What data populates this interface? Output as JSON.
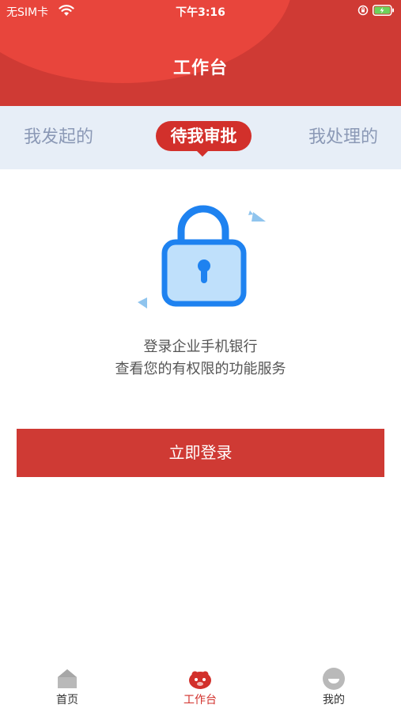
{
  "status_bar": {
    "carrier": "无SIM卡",
    "time": "下午3:16"
  },
  "header": {
    "title": "工作台"
  },
  "tabs": [
    {
      "label": "我发起的",
      "active": false
    },
    {
      "label": "待我审批",
      "active": true
    },
    {
      "label": "我处理的",
      "active": false
    }
  ],
  "message": {
    "line1": "登录企业手机银行",
    "line2": "查看您的有权限的功能服务"
  },
  "login_button": {
    "label": "立即登录"
  },
  "bottom_nav": {
    "items": [
      {
        "label": "首页",
        "icon": "home-icon",
        "active": false
      },
      {
        "label": "工作台",
        "icon": "workbench-icon",
        "active": true
      },
      {
        "label": "我的",
        "icon": "profile-icon",
        "active": false
      }
    ]
  },
  "colors": {
    "brand_red": "#cf3a34",
    "active_red": "#d2302b",
    "tab_bg": "#e7eef7",
    "tab_inactive": "#8b99b6",
    "lock_blue": "#1e82f0"
  }
}
